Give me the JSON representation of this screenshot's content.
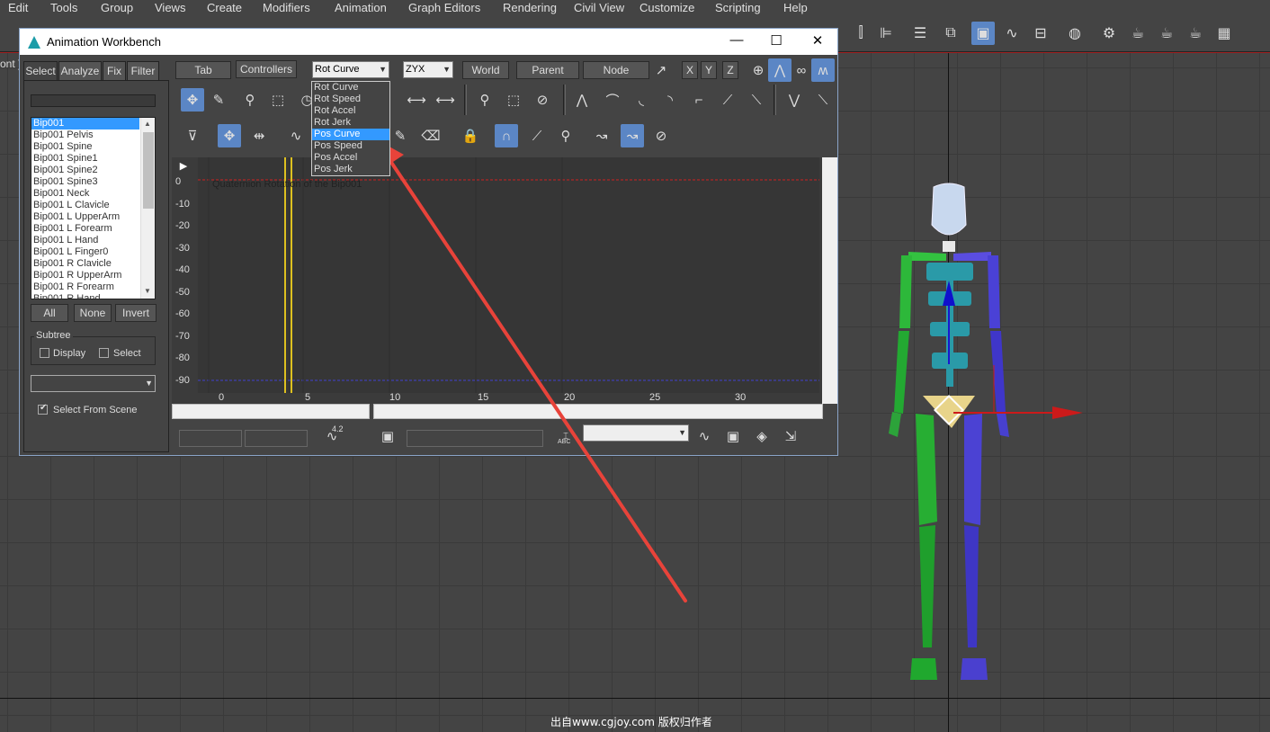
{
  "menubar": {
    "items": [
      "Edit",
      "Tools",
      "Group",
      "Views",
      "Create",
      "Modifiers",
      "Animation",
      "Graph Editors",
      "Rendering",
      "Civil View",
      "Customize",
      "Scripting",
      "Help"
    ]
  },
  "viewport": {
    "label": "ont ]"
  },
  "watermark": "出自www.cgjoy.com 版权归作者",
  "window": {
    "title": "Animation Workbench",
    "minimize": "—",
    "maximize": "☐",
    "close": "✕"
  },
  "left_tabs": [
    "Select",
    "Analyze",
    "Fix",
    "Filter"
  ],
  "object_list": [
    "Bip001",
    "Bip001 Pelvis",
    "Bip001 Spine",
    "Bip001 Spine1",
    "Bip001 Spine2",
    "Bip001 Spine3",
    "Bip001 Neck",
    "Bip001 L Clavicle",
    "Bip001 L UpperArm",
    "Bip001 L Forearm",
    "Bip001 L Hand",
    "Bip001 L Finger0",
    "Bip001 R Clavicle",
    "Bip001 R UpperArm",
    "Bip001 R Forearm",
    "Bip001 R Hand"
  ],
  "selection_buttons": {
    "all": "All",
    "none": "None",
    "invert": "Invert"
  },
  "subtree": {
    "label": "Subtree",
    "display": "Display",
    "select": "Select"
  },
  "select_from_scene": "Select From Scene",
  "top_controls": {
    "tab": "Tab",
    "controllers": "Controllers",
    "curve_combo": "Rot Curve",
    "order_combo": "ZYX",
    "world": "World",
    "parent": "Parent",
    "node": "Node",
    "x": "X",
    "y": "Y",
    "z": "Z"
  },
  "curve_options": [
    "Rot Curve",
    "Rot Speed",
    "Rot Accel",
    "Rot Jerk",
    "Pos Curve",
    "Pos Speed",
    "Pos Accel",
    "Pos Jerk"
  ],
  "graph": {
    "title": "Quaternion Rotation of the Bip001",
    "y_ticks": [
      "0",
      "-10",
      "-20",
      "-30",
      "-40",
      "-50",
      "-60",
      "-70",
      "-80",
      "-90"
    ],
    "x_ticks": [
      "0",
      "5",
      "10",
      "15",
      "20",
      "25",
      "30"
    ]
  },
  "bottom": {
    "value_label": "4.2",
    "abc_label": "ABC"
  },
  "colors": {
    "accent": "#5b86c5",
    "selection": "#3399ff",
    "annotation_arrow": "#e8433a"
  }
}
